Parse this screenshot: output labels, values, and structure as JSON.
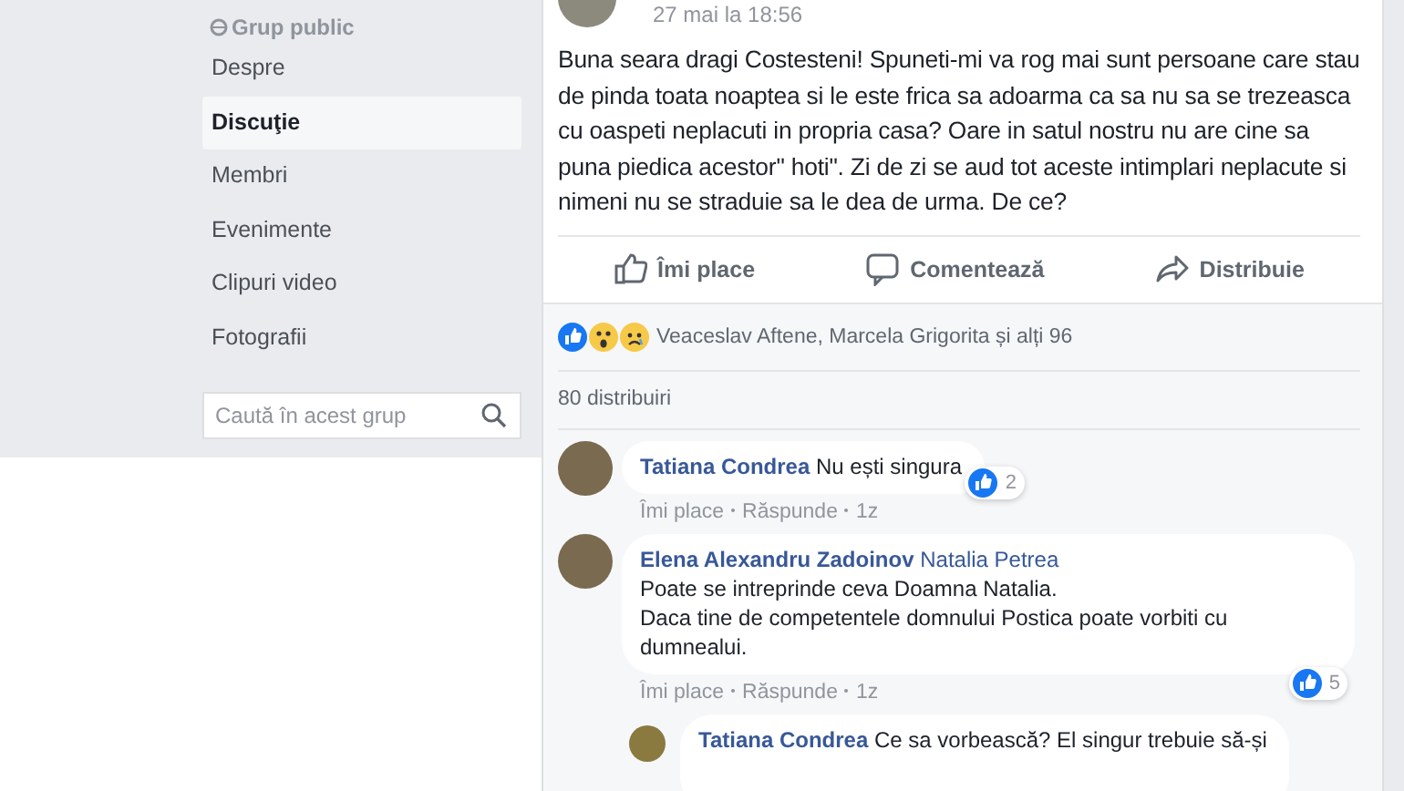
{
  "sidebar": {
    "privacy": "Grup public",
    "items": [
      {
        "label": "Despre",
        "selected": false
      },
      {
        "label": "Discuţie",
        "selected": true
      },
      {
        "label": "Membri",
        "selected": false
      },
      {
        "label": "Evenimente",
        "selected": false
      },
      {
        "label": "Clipuri video",
        "selected": false
      },
      {
        "label": "Fotografii",
        "selected": false
      }
    ],
    "search": {
      "placeholder": "Caută în acest grup"
    }
  },
  "post": {
    "date": "27 mai la 18:56",
    "text": "Buna seara dragi Costesteni! Spuneti-mi va rog mai sunt persoane care stau de pinda toata noaptea si le este frica sa adoarma ca sa nu sa se trezeasca cu oaspeti neplacuti in propria casa? Oare in satul nostru nu are cine sa puna piedica acestor\" hoti\". Zi de zi se aud tot aceste intimplari neplacute si nimeni nu se straduie sa le dea de urma. De ce?",
    "actions": [
      {
        "kind": "like",
        "label": "Îmi place"
      },
      {
        "kind": "comment",
        "label": "Comentează"
      },
      {
        "kind": "share",
        "label": "Distribuie"
      }
    ],
    "reactions": "Veaceslav Aftene, Marcela Grigorita și alți 96",
    "shares": "80 distribuiri",
    "comments": [
      {
        "author": "Tatiana Condrea",
        "text": "Nu ești singura",
        "likes": "2",
        "actions": [
          "Îmi place",
          "Răspunde",
          "1z"
        ]
      },
      {
        "author": "Elena Alexandru Zadoinov",
        "mention": "Natalia Petrea",
        "text": "Poate se intreprinde ceva Doamna Natalia.\nDaca tine de competentele domnului Postica poate vorbiti cu dumnealui.",
        "likes": "5",
        "actions": [
          "Îmi place",
          "Răspunde",
          "1z"
        ],
        "children": [
          {
            "author": "Tatiana Condrea",
            "text": "Ce sa vorbească? El singur trebuie să-și"
          }
        ]
      }
    ]
  }
}
